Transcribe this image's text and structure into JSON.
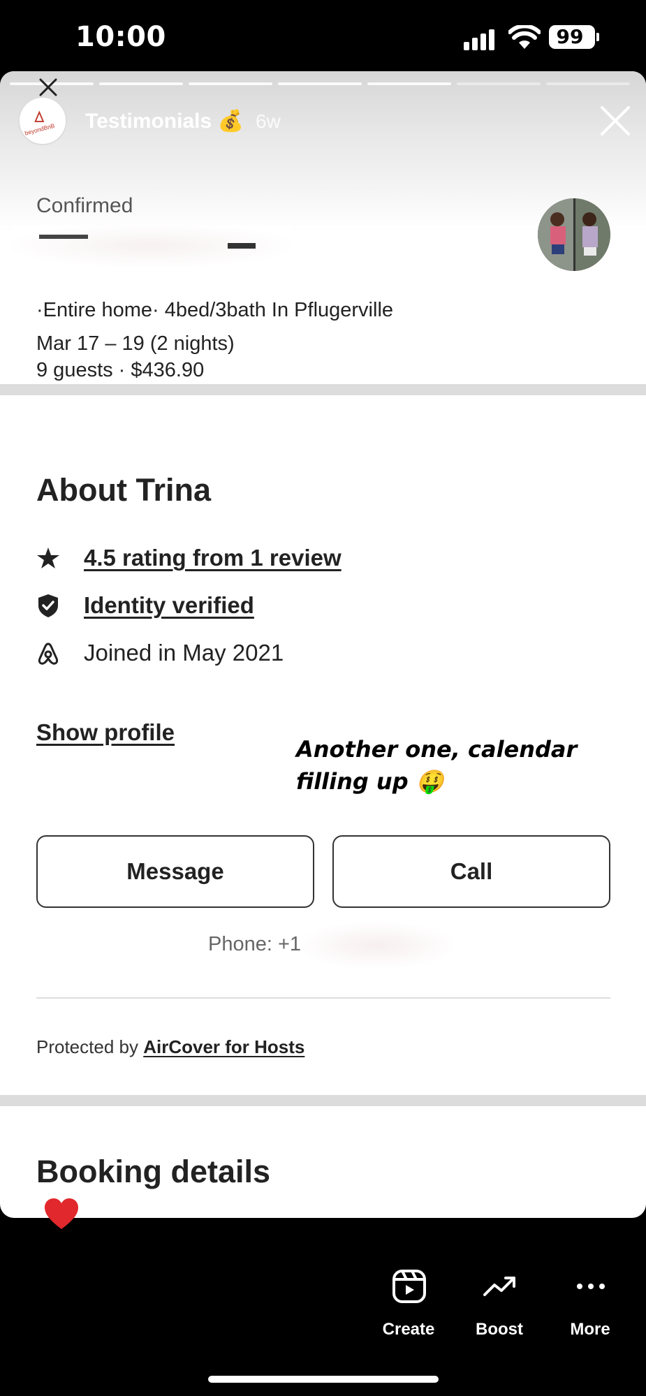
{
  "status_bar": {
    "time": "10:00",
    "battery": "99"
  },
  "story": {
    "title": "Testimonials 💰",
    "age": "6w",
    "progress_segments_total": 7,
    "progress_segments_complete": 5,
    "logo_text": "beyondBnB"
  },
  "reservation": {
    "status": "Confirmed",
    "listing": "·Entire home· 4bed/3bath In Pflugerville",
    "dates": "Mar 17 – 19 (2 nights)",
    "guests_price": "9 guests · $436.90"
  },
  "about": {
    "title": "About Trina",
    "rating_text": "4.5 rating from 1 review",
    "identity_text": "Identity verified",
    "joined_text": "Joined in May 2021",
    "show_profile": "Show profile"
  },
  "overlay": {
    "line1": "Another one, calendar",
    "line2": "filling up 🤑"
  },
  "buttons": {
    "message": "Message",
    "call": "Call"
  },
  "phone": {
    "label": "Phone: +1 "
  },
  "protection": {
    "prefix": "Protected by ",
    "link": "AirCover for Hosts"
  },
  "booking": {
    "title": "Booking details"
  },
  "bottom_actions": {
    "create": "Create",
    "boost": "Boost",
    "more": "More"
  },
  "colors": {
    "heart": "#e0282d",
    "text": "#222222",
    "background": "#000000"
  }
}
